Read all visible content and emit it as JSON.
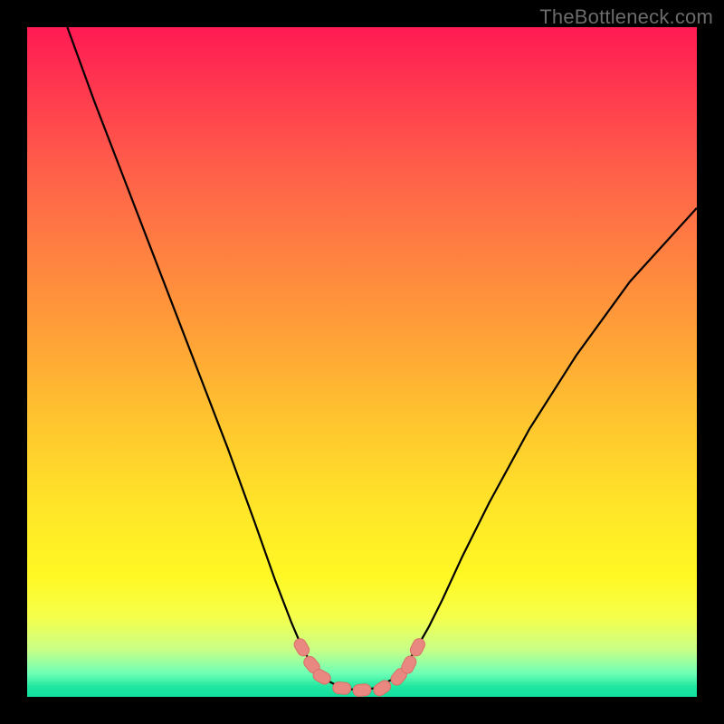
{
  "watermark": "TheBottleneck.com",
  "colors": {
    "frame": "#000000",
    "curve": "#000000",
    "marker_fill": "#e98880",
    "marker_stroke": "#da6f66"
  },
  "chart_data": {
    "type": "line",
    "title": "",
    "xlabel": "",
    "ylabel": "",
    "xlim": [
      0,
      100
    ],
    "ylim": [
      0,
      100
    ],
    "series": [
      {
        "name": "bottleneck-curve",
        "x": [
          6,
          10,
          15,
          20,
          25,
          30,
          34,
          37,
          39.5,
          41,
          42.5,
          44.5,
          47,
          49.5,
          52,
          54.5,
          56.5,
          58,
          60,
          62,
          65,
          69,
          75,
          82,
          90,
          100
        ],
        "values": [
          100,
          89,
          76,
          63,
          50,
          37,
          26,
          17.5,
          11,
          7.5,
          4.8,
          2.6,
          1.3,
          1.0,
          1.3,
          2.6,
          4.8,
          7.0,
          10.5,
          14.5,
          21,
          29,
          40,
          51,
          62,
          73
        ]
      }
    ],
    "markers": {
      "name": "highlighted-points",
      "shape": "pill",
      "x": [
        41.0,
        42.5,
        44.0,
        47.0,
        50.0,
        53.0,
        55.5,
        57.0,
        58.3
      ],
      "values": [
        7.4,
        4.8,
        3.0,
        1.3,
        1.0,
        1.3,
        3.0,
        4.8,
        7.4
      ]
    }
  }
}
